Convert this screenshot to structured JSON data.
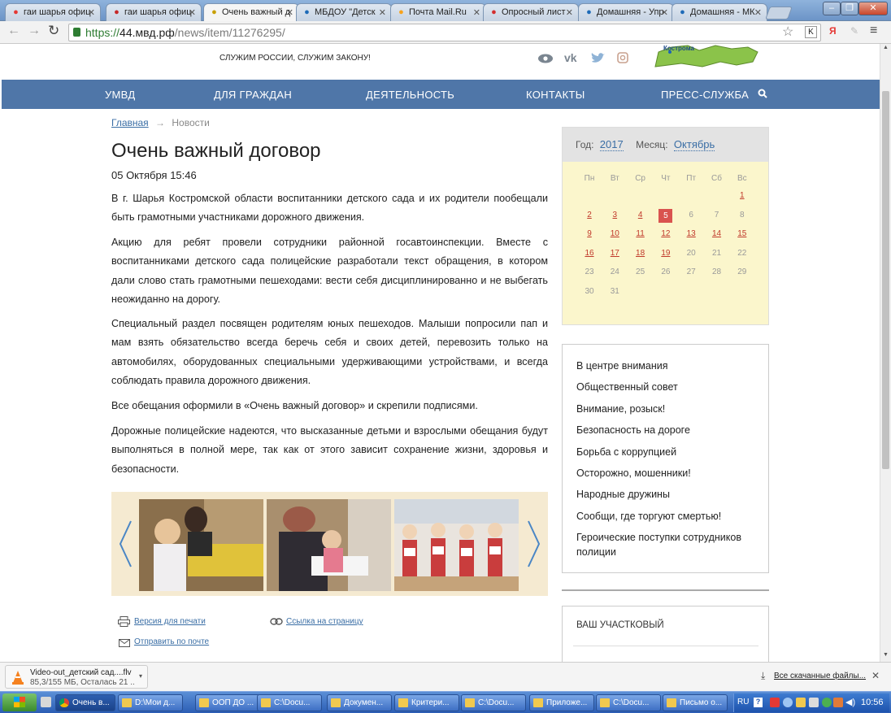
{
  "browser": {
    "tabs": [
      {
        "label": "гаи шарья офиц",
        "icon": "yandex-icon",
        "color": "#e53935"
      },
      {
        "label": "гаи шарья офиц",
        "icon": "news-icon",
        "color": "#c62828"
      },
      {
        "label": "Очень важный д",
        "icon": "mvd-icon",
        "color": "#c8a000"
      },
      {
        "label": "МБДОУ \"Детск",
        "icon": "site-icon",
        "color": "#1e6bb8"
      },
      {
        "label": "Почта Mail.Ru",
        "icon": "mail-icon",
        "color": "#f7a21b"
      },
      {
        "label": "Опросный лист",
        "icon": "forms-icon",
        "color": "#d32f2f"
      },
      {
        "label": "Домашняя - Упр",
        "icon": "site-icon",
        "color": "#1e6bb8"
      },
      {
        "label": "Домашняя - МК",
        "icon": "site-icon",
        "color": "#1e6bb8"
      }
    ],
    "url_scheme": "https://",
    "url_host": "44.мвд.рф",
    "url_path": "/news/item/11276295/"
  },
  "site": {
    "motto": "СЛУЖИМ РОССИИ, СЛУЖИМ ЗАКОНУ!",
    "map_label": "Кострома",
    "nav": [
      "УМВД",
      "ДЛЯ ГРАЖДАН",
      "ДЕЯТЕЛЬНОСТЬ",
      "КОНТАКТЫ",
      "ПРЕСС-СЛУЖБА"
    ]
  },
  "breadcrumb": {
    "home": "Главная",
    "arrow": "→",
    "current": "Новости"
  },
  "article": {
    "title": "Очень важный договор",
    "date": "05 Октября 15:46",
    "paragraphs": [
      "В г. Шарья Костромской области воспитанники детского сада и их родители пообещали быть грамотными участниками дорожного движения.",
      "Акцию для ребят провели сотрудники районной госавтоинспекции. Вместе с воспитанниками детского сада полицейские разработали текст обращения, в котором дали слово стать грамотными пешеходами: вести себя дисциплинированно и не выбегать неожиданно на дорогу.",
      "Специальный раздел посвящен родителям юных пешеходов. Малыши попросили пап и мам взять обязательство всегда беречь себя и своих детей, перевозить только на автомобилях, оборудованных специальными удерживающими устройствами, и всегда соблюдать правила дорожного движения.",
      "Все обещания оформили в «Очень важный договор» и скрепили подписями.",
      "Дорожные полицейские надеются, что высказанные детьми и взрослыми обещания будут выполняться в полной мере, так как от этого зависит сохранение жизни, здоровья и безопасности."
    ],
    "print_link": "Версия для печати",
    "share_link": "Ссылка на страницу",
    "email_link": "Отправить по почте"
  },
  "calendar": {
    "year_label": "Год:",
    "year": "2017",
    "month_label": "Месяц:",
    "month": "Октябрь",
    "weekdays": [
      "Пн",
      "Вт",
      "Ср",
      "Чт",
      "Пт",
      "Сб",
      "Вс"
    ],
    "leading_blanks": 6,
    "days": 31,
    "today": 5,
    "linked_days": [
      1,
      2,
      3,
      4,
      5,
      9,
      10,
      11,
      12,
      13,
      14,
      15,
      16,
      17,
      18,
      19
    ]
  },
  "sidebar_menu": [
    "В центре внимания",
    "Общественный совет",
    "Внимание, розыск!",
    "Безопасность на дороге",
    "Борьба с коррупцией",
    "Осторожно, мошенники!",
    "Народные дружины",
    "Сообщи, где торгуют смертью!",
    "Героические поступки сотрудников полиции"
  ],
  "sidebar_block2_title": "ВАШ УЧАСТКОВЫЙ",
  "download": {
    "filename": "Video-out_детский сад....flv",
    "progress": "85,3/155 МБ, Осталась 21 ...",
    "all_downloads": "Все скачанные файлы..."
  },
  "taskbar": {
    "items": [
      "Очень в...",
      "D:\\Мои д...",
      "ООП ДО ...",
      "C:\\Docu...",
      "Докумен...",
      "Критери...",
      "C:\\Docu...",
      "Приложе...",
      "C:\\Docu...",
      "Письмо о..."
    ],
    "lang": "RU",
    "clock": "10:56"
  }
}
